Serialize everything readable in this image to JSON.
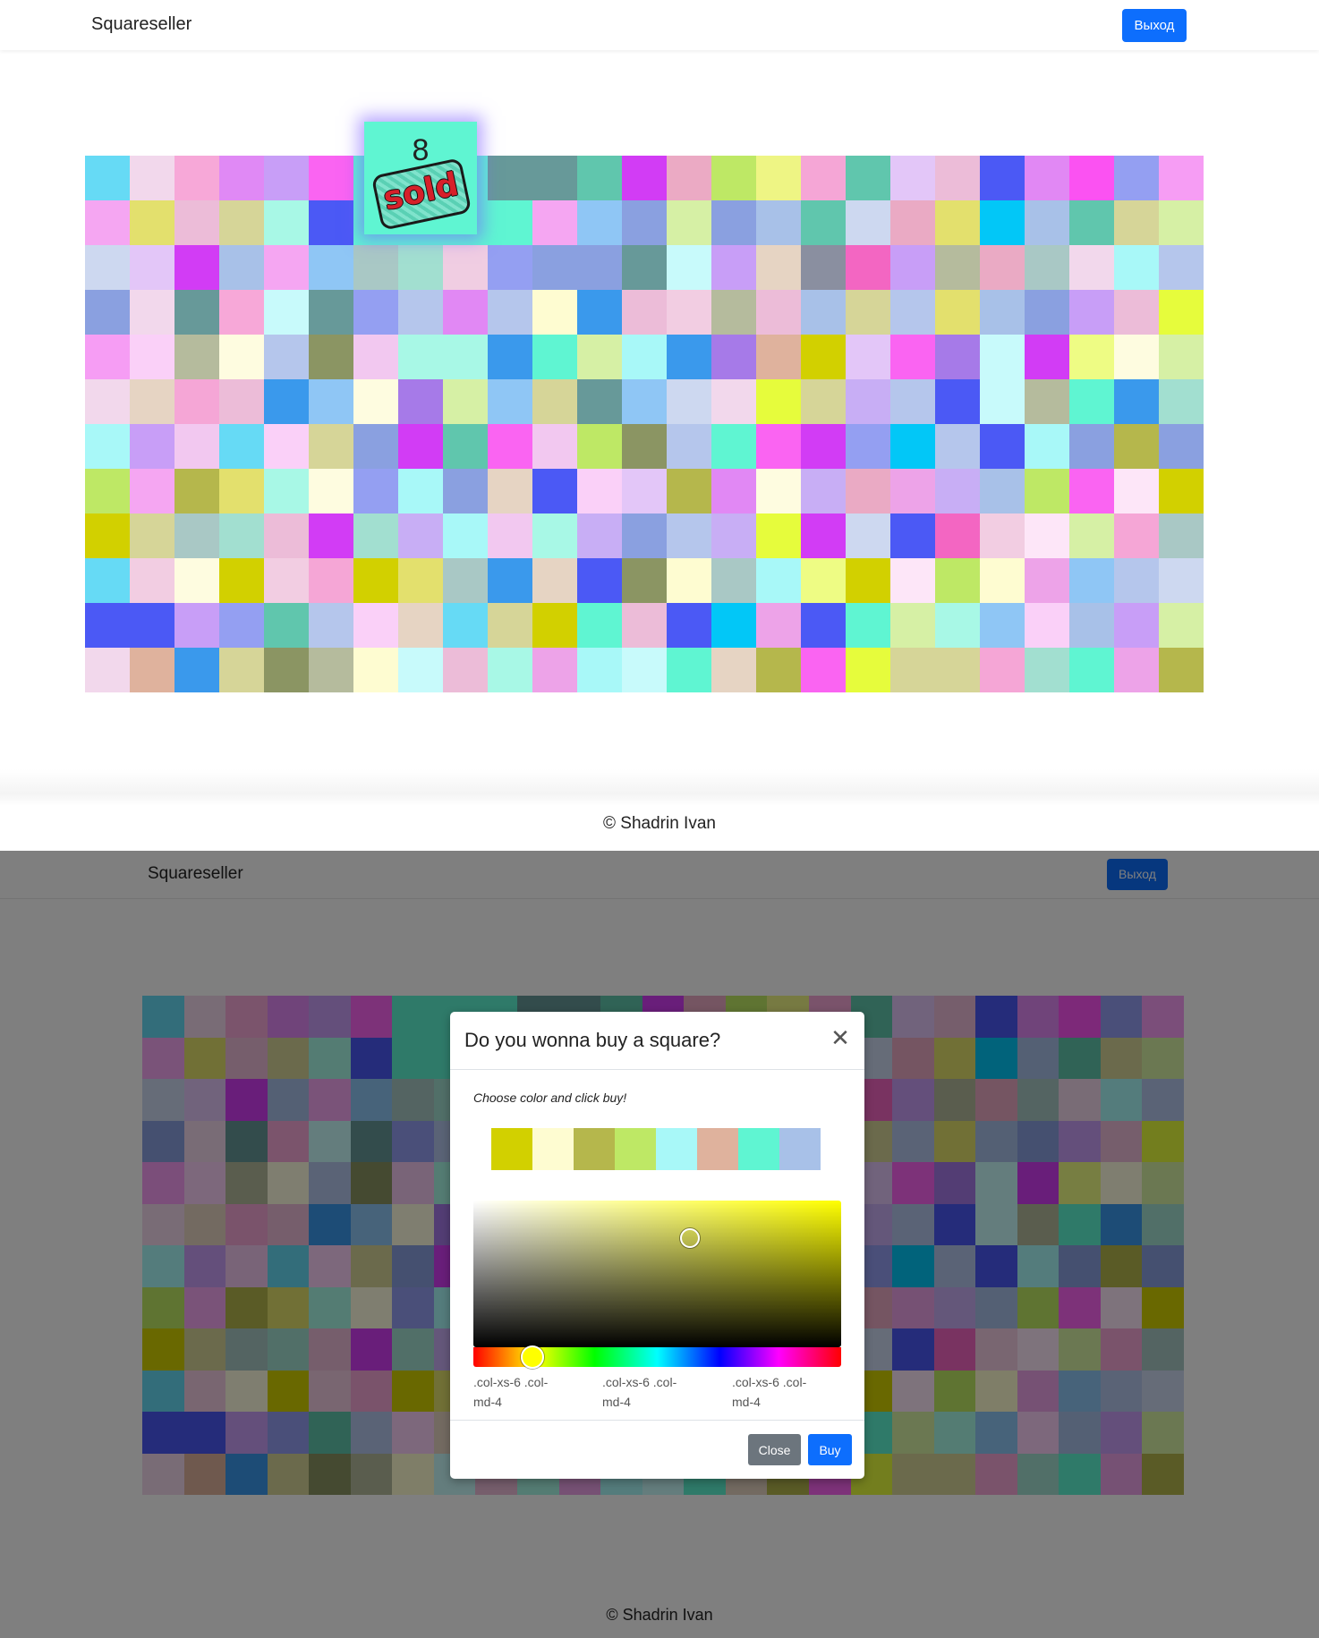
{
  "app": {
    "brand": "Squareseller",
    "logout_label": "Выход",
    "footer": "© Shadrin Ivan"
  },
  "board": {
    "columns": 25,
    "rows": 12,
    "colors": [
      "#66daf5",
      "#f2d8ec",
      "#f7a8d8",
      "#e089f5",
      "#c89ef7",
      "#fa64f2",
      "#5ff5d2",
      "#5ff5d2",
      "#5ff5d2",
      "#679999",
      "#679999",
      "#60c6ad",
      "#d23cf5",
      "#ebaac4",
      "#bee865",
      "#eef584",
      "#f5a6d6",
      "#60c6ad",
      "#e3c6f8",
      "#ecbcd8",
      "#4b59f5",
      "#e188f4",
      "#fb52f2",
      "#949ff2",
      "#f69df4",
      "#f5a6f2",
      "#e3e06d",
      "#ecbcd8",
      "#d6d598",
      "#a8f8e6",
      "#4b59f5",
      "#5ff5d2",
      "#5ff5d2",
      "#5ff5d2",
      "#5ff5d2",
      "#f5a6f2",
      "#8fc6f5",
      "#8aa0e0",
      "#d6f0a5",
      "#8aa0e0",
      "#a8c1e8",
      "#60c6ad",
      "#cdd8f0",
      "#eaaac4",
      "#e3e06d",
      "#02c7f7",
      "#a8c1e8",
      "#60c6ad",
      "#d6d598",
      "#d6f0a5",
      "#cdd8f0",
      "#e3c6f8",
      "#d23cf5",
      "#a8c1e8",
      "#f5a6f2",
      "#8fc6f5",
      "#a9c8c5",
      "#a2dfd0",
      "#f0cde2",
      "#949ff2",
      "#8aa0e0",
      "#8aa0e0",
      "#679999",
      "#c8fafb",
      "#c89ef7",
      "#e6d4c3",
      "#8a8fa0",
      "#f366c2",
      "#c89ef7",
      "#b5bb9d",
      "#eaaac4",
      "#a9c8c5",
      "#f2d8ec",
      "#a8f8f8",
      "#b5c6ec",
      "#8aa0e0",
      "#f2d8ec",
      "#679999",
      "#f7a8d8",
      "#c8fafb",
      "#679999",
      "#949ff2",
      "#b5c6ec",
      "#e188f4",
      "#b5c6ec",
      "#fefcd1",
      "#3a99ec",
      "#ecbcd8",
      "#f2cde2",
      "#b5bb9d",
      "#ecbcd8",
      "#a8c1e8",
      "#d6d598",
      "#b5c6ec",
      "#e3e06d",
      "#a8c1e8",
      "#8aa0e0",
      "#c89ef7",
      "#ecbcd8",
      "#e6fc3c",
      "#f69df4",
      "#fad0f8",
      "#b5bb9d",
      "#fefce0",
      "#b5c6ec",
      "#8b9563",
      "#f2c8f0",
      "#a8f8e6",
      "#a8f8e6",
      "#3a99ec",
      "#5ff5d2",
      "#d6f0a5",
      "#a8f8f8",
      "#3a99ec",
      "#a67ae8",
      "#dfb29d",
      "#d2d000",
      "#e3c6f8",
      "#fa64f2",
      "#a67ae8",
      "#c8fafb",
      "#d23cf5",
      "#eefc84",
      "#fefce0",
      "#d6f0a5",
      "#f2d8ec",
      "#e6d4c3",
      "#f5a6d6",
      "#ecbcd8",
      "#3a99ec",
      "#8fc6f5",
      "#fefce0",
      "#a67ae8",
      "#d6f0a5",
      "#8fc6f5",
      "#d6d598",
      "#679999",
      "#8fc6f5",
      "#cdd8f0",
      "#f2d8ec",
      "#e6fc3c",
      "#d6d598",
      "#c8aef5",
      "#b5c6ec",
      "#4b59f5",
      "#c8fafb",
      "#b5bb9d",
      "#5ff5d2",
      "#3a99ec",
      "#a2dfd0",
      "#a8f8f8",
      "#c89ef7",
      "#f2c8f0",
      "#66daf5",
      "#fad0f8",
      "#d6d598",
      "#8aa0e0",
      "#d23cf5",
      "#60c6ad",
      "#fa64f2",
      "#f2c8f0",
      "#bee865",
      "#8b9563",
      "#b5c6ec",
      "#5ff5d2",
      "#fa64f2",
      "#d23cf5",
      "#949ff2",
      "#02c7f7",
      "#b5c6ec",
      "#4b59f5",
      "#a8f8f8",
      "#8aa0e0",
      "#b5b74c",
      "#8aa0e0",
      "#bee865",
      "#f5a6f2",
      "#b5b74c",
      "#e3e06d",
      "#a8f8e6",
      "#fefce0",
      "#949ff2",
      "#a8f8f8",
      "#8aa0e0",
      "#e6d4c3",
      "#4b59f5",
      "#fad0f8",
      "#e3c6f8",
      "#b5b74c",
      "#e188f4",
      "#fefce0",
      "#c8aef5",
      "#eaaac4",
      "#eda3e8",
      "#c8aef5",
      "#a8c1e8",
      "#bee865",
      "#fa64f2",
      "#fde6f8",
      "#d2d000",
      "#d2d000",
      "#d6d598",
      "#a9c8c5",
      "#a2dfd0",
      "#ecbcd8",
      "#d23cf5",
      "#a2dfd0",
      "#c8aef5",
      "#a8f8f8",
      "#f2c8f0",
      "#a8f8e6",
      "#c8aef5",
      "#8aa0e0",
      "#b5c6ec",
      "#c8aef5",
      "#e6fc3c",
      "#d23cf5",
      "#cdd8f0",
      "#4b59f5",
      "#f366c2",
      "#f2cde2",
      "#fde6f8",
      "#d6f0a5",
      "#f5a6d6",
      "#a9c8c5",
      "#66daf5",
      "#f2cde2",
      "#fefce0",
      "#d2d000",
      "#f2cde2",
      "#f5a6d6",
      "#d2d000",
      "#e3e06d",
      "#a9c8c5",
      "#3a99ec",
      "#e6d4c3",
      "#4b59f5",
      "#8b9563",
      "#fefcd1",
      "#a9c8c5",
      "#a8f8f8",
      "#eefc84",
      "#d2d000",
      "#fde6f8",
      "#bee865",
      "#fefcd1",
      "#eda3e8",
      "#8fc6f5",
      "#b5c6ec",
      "#cdd8f0",
      "#4b59f5",
      "#4b59f5",
      "#c89ef7",
      "#949ff2",
      "#60c6ad",
      "#b5c6ec",
      "#fad0f8",
      "#e6d4c3",
      "#66daf5",
      "#d6d598",
      "#d2d000",
      "#5ff5d2",
      "#ecbcd8",
      "#4b59f5",
      "#02c7f7",
      "#eda3e8",
      "#4b59f5",
      "#5ff5d2",
      "#d6f0a5",
      "#a8f8e6",
      "#8fc6f5",
      "#fad0f8",
      "#a8c1e8",
      "#c89ef7",
      "#d6f0a5",
      "#f2d8ec",
      "#dfb29d",
      "#3a99ec",
      "#d6d598",
      "#8b9563",
      "#b5bb9d",
      "#fefcd1",
      "#c8fafb",
      "#ecbcd8",
      "#a8f8e6",
      "#eda3e8",
      "#a8f8f8",
      "#c8fafb",
      "#5ff5d2",
      "#e6d4c3",
      "#b5b74c",
      "#fa64f2",
      "#e6fc3c",
      "#d6d598",
      "#d6d598",
      "#f5a6d6",
      "#a2dfd0",
      "#5ff5d2",
      "#eda3e8",
      "#b5b74c",
      "#eda3e8"
    ],
    "sold_square": {
      "number": "8",
      "stamp_text": "sold",
      "color": "#5ff5d2"
    }
  },
  "modal": {
    "title": "Do you wonna buy a square?",
    "hint": "Choose color and click buy!",
    "palette": [
      "#d2d000",
      "#fefcd1",
      "#b5b74c",
      "#bee865",
      "#a8f8f8",
      "#dfb29d",
      "#5ff5d2",
      "#a8c1e8"
    ],
    "picker": {
      "hue_color": "#ffff00"
    },
    "col_labels": [
      ".col-xs-6 .col-md-4",
      ".col-xs-6 .col-md-4",
      ".col-xs-6 .col-md-4"
    ],
    "close_label": "Close",
    "buy_label": "Buy"
  }
}
